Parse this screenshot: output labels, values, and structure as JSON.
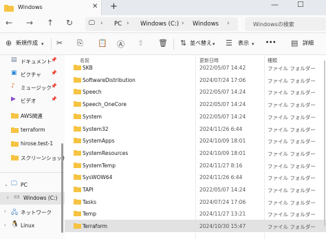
{
  "window": {
    "tab_title": "Windows",
    "new_tab_label": "+",
    "address": {
      "segments": [
        "PC",
        "Windows (C:)",
        "Windows"
      ],
      "search_placeholder": "Windowsの検索"
    }
  },
  "toolbar": {
    "new_label": "新規作成",
    "sort_label": "並べ替え",
    "view_label": "表示",
    "more_label": "•••",
    "details_label": "詳細"
  },
  "sidebar": {
    "quick_access": [
      {
        "label": "ドキュメント",
        "icon": "documents-icon"
      },
      {
        "label": "ピクチャ",
        "icon": "pictures-icon"
      },
      {
        "label": "ミュージック",
        "icon": "music-icon"
      },
      {
        "label": "ビデオ",
        "icon": "videos-icon"
      },
      {
        "label": "AWS関連",
        "icon": "folder-icon"
      },
      {
        "label": "terraform",
        "icon": "folder-icon"
      },
      {
        "label": "hirose.test-1",
        "icon": "folder-icon"
      },
      {
        "label": "スクリーンショット",
        "icon": "folder-icon"
      }
    ],
    "tree": [
      {
        "label": "PC",
        "icon": "pc-icon"
      },
      {
        "label": "Windows (C:)",
        "icon": "drive-icon"
      },
      {
        "label": "ネットワーク",
        "icon": "network-icon"
      },
      {
        "label": "Linux",
        "icon": "linux-icon"
      }
    ]
  },
  "columns": {
    "name": "名前",
    "date": "更新日時",
    "type": "種類"
  },
  "files": [
    {
      "name": "SKB",
      "date": "2022/05/07 14:42",
      "type": "ファイル フォルダー"
    },
    {
      "name": "SoftwareDistribution",
      "date": "2024/07/24 17:06",
      "type": "ファイル フォルダー"
    },
    {
      "name": "Speech",
      "date": "2022/05/07 14:24",
      "type": "ファイル フォルダー"
    },
    {
      "name": "Speech_OneCore",
      "date": "2022/05/07 14:24",
      "type": "ファイル フォルダー"
    },
    {
      "name": "System",
      "date": "2022/05/07 14:24",
      "type": "ファイル フォルダー"
    },
    {
      "name": "System32",
      "date": "2024/11/26 6:44",
      "type": "ファイル フォルダー"
    },
    {
      "name": "SystemApps",
      "date": "2024/10/09 18:01",
      "type": "ファイル フォルダー"
    },
    {
      "name": "SystemResources",
      "date": "2024/10/09 18:01",
      "type": "ファイル フォルダー"
    },
    {
      "name": "SystemTemp",
      "date": "2024/11/27 8:16",
      "type": "ファイル フォルダー"
    },
    {
      "name": "SysWOW64",
      "date": "2024/11/26 6:44",
      "type": "ファイル フォルダー"
    },
    {
      "name": "TAPI",
      "date": "2022/05/07 14:24",
      "type": "ファイル フォルダー"
    },
    {
      "name": "Tasks",
      "date": "2024/07/24 17:06",
      "type": "ファイル フォルダー"
    },
    {
      "name": "Temp",
      "date": "2024/11/27 13:21",
      "type": "ファイル フォルダー"
    },
    {
      "name": "Terraform",
      "date": "2024/10/30 15:47",
      "type": "ファイル フォルダー"
    }
  ],
  "colors": {
    "folder": "#f6c342",
    "accent": "#0067c0",
    "selected_row": "#e2e2e2"
  }
}
